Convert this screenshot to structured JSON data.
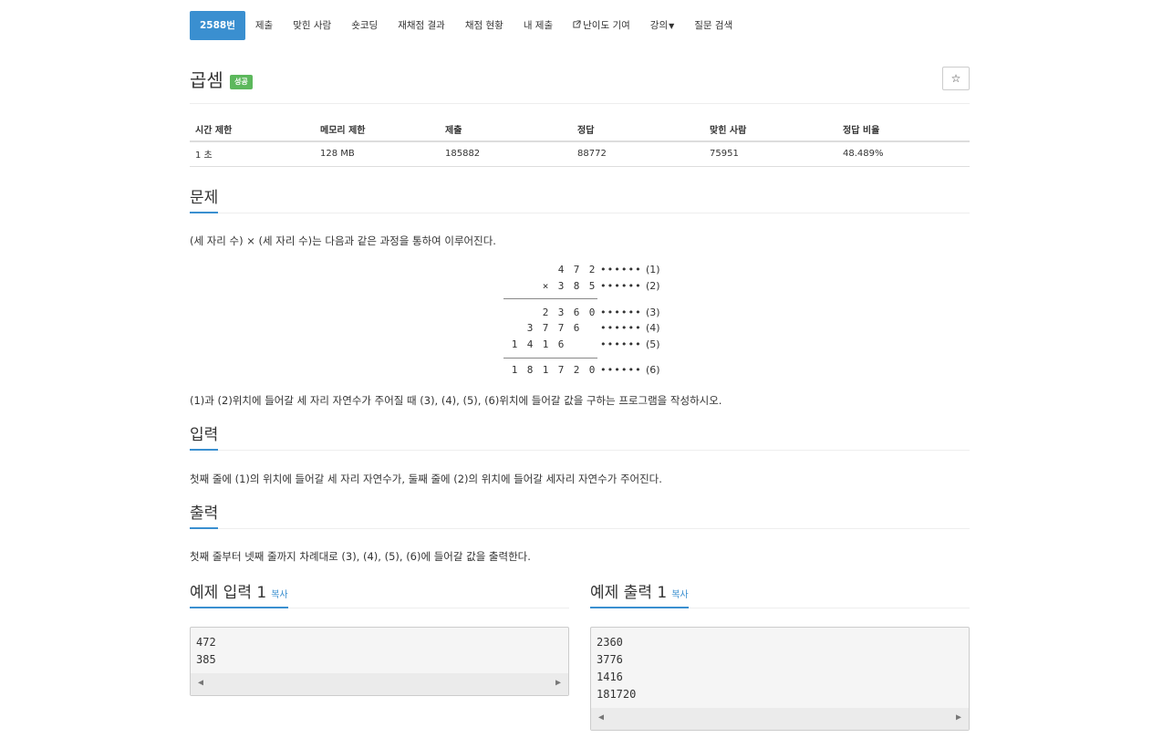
{
  "nav": {
    "tabs": [
      {
        "label": "2588번",
        "active": true
      },
      {
        "label": "제출"
      },
      {
        "label": "맞힌 사람"
      },
      {
        "label": "숏코딩"
      },
      {
        "label": "재채점 결과"
      },
      {
        "label": "채점 현황"
      },
      {
        "label": "내 제출"
      },
      {
        "label": "난이도 기여",
        "icon": "external-link-icon"
      },
      {
        "label": "강의",
        "icon": "caret-down-icon"
      },
      {
        "label": "질문 검색"
      }
    ]
  },
  "problem": {
    "title": "곱셈",
    "badge": "성공",
    "star_icon": "☆"
  },
  "info_table": {
    "headers": [
      "시간 제한",
      "메모리 제한",
      "제출",
      "정답",
      "맞힌 사람",
      "정답 비율"
    ],
    "values": [
      "1 초",
      "128 MB",
      "185882",
      "88772",
      "75951",
      "48.489%"
    ]
  },
  "sections": {
    "description": {
      "heading": "문제",
      "text1": "(세 자리 수) × (세 자리 수)는 다음과 같은 과정을 통하여 이루어진다.",
      "text2": "(1)과 (2)위치에 들어갈 세 자리 자연수가 주어질 때 (3), (4), (5), (6)위치에 들어갈 값을 구하는 프로그램을 작성하시오."
    },
    "input": {
      "heading": "입력",
      "text": "첫째 줄에 (1)의 위치에 들어갈 세 자리 자연수가, 둘째 줄에 (2)의 위치에 들어갈 세자리 자연수가 주어진다."
    },
    "output": {
      "heading": "출력",
      "text": "첫째 줄부터 넷째 줄까지 차례대로 (3), (4), (5), (6)에 들어갈 값을 출력한다."
    }
  },
  "figure": {
    "dots": "••••••",
    "rows": [
      {
        "digits": [
          "",
          "",
          "4",
          "7",
          "2"
        ],
        "prefix": "",
        "label": "(1)"
      },
      {
        "digits": [
          "",
          "",
          "3",
          "8",
          "5"
        ],
        "prefix": "×",
        "label": "(2)"
      },
      {
        "digits": [
          "",
          "2",
          "3",
          "6",
          "0"
        ],
        "prefix": "",
        "label": "(3)"
      },
      {
        "digits": [
          "3",
          "7",
          "7",
          "6",
          ""
        ],
        "prefix": "",
        "label": "(4)",
        "shift": 1
      },
      {
        "digits": [
          "1",
          "4",
          "1",
          "6",
          ""
        ],
        "prefix": "",
        "label": "(5)",
        "shift": 2
      },
      {
        "digits": [
          "1",
          "8",
          "1",
          "7",
          "2",
          "0"
        ],
        "prefix": "",
        "label": "(6)"
      }
    ]
  },
  "samples": {
    "input": {
      "heading": "예제 입력 1",
      "copy": "복사",
      "lines": [
        "472",
        "385"
      ]
    },
    "output": {
      "heading": "예제 출력 1",
      "copy": "복사",
      "lines": [
        "2360",
        "3776",
        "1416",
        "181720"
      ]
    }
  }
}
